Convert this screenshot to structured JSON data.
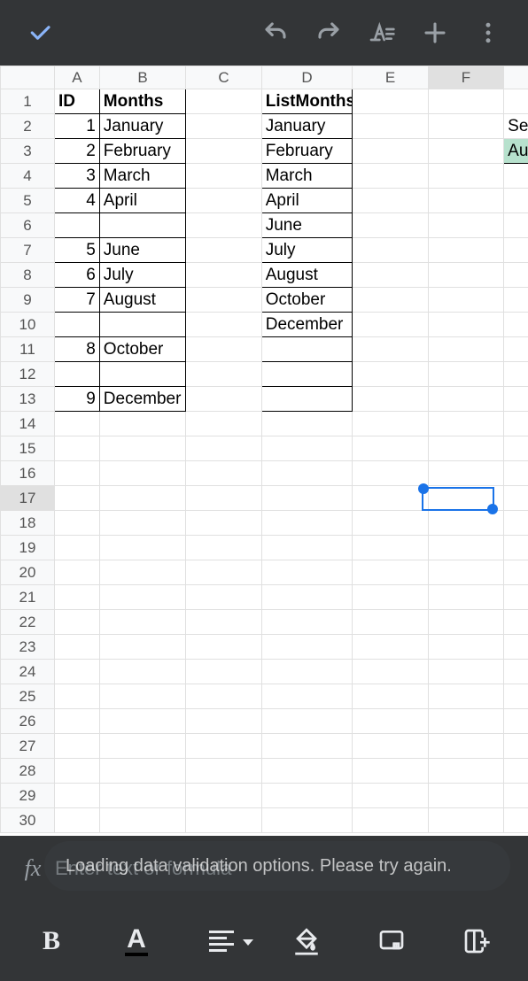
{
  "toolbar": {
    "check": "check",
    "undo": "undo",
    "redo": "redo",
    "text_format": "text-format",
    "plus": "plus",
    "more": "more"
  },
  "columns": [
    "A",
    "B",
    "C",
    "D",
    "E",
    "F"
  ],
  "rows_count": 30,
  "selected_col": "F",
  "selected_row": 17,
  "cells": {
    "A1": {
      "v": "ID",
      "bold": true,
      "bord": true
    },
    "B1": {
      "v": "Months",
      "bold": true,
      "bord": true
    },
    "D1": {
      "v": "ListMonths",
      "bold": true,
      "bord": true
    },
    "A2": {
      "v": "1",
      "num": true,
      "bord": true
    },
    "B2": {
      "v": "January",
      "bord": true
    },
    "D2": {
      "v": "January",
      "bord": true
    },
    "G2": {
      "v": "Sel"
    },
    "A3": {
      "v": "2",
      "num": true,
      "bord": true
    },
    "B3": {
      "v": "February",
      "bord": true
    },
    "D3": {
      "v": "February",
      "bord": true
    },
    "G3": {
      "v": "Aug",
      "green": true,
      "bord": true
    },
    "A4": {
      "v": "3",
      "num": true,
      "bord": true
    },
    "B4": {
      "v": "March",
      "bord": true
    },
    "D4": {
      "v": "March",
      "bord": true
    },
    "A5": {
      "v": "4",
      "num": true,
      "bord": true
    },
    "B5": {
      "v": "April",
      "bord": true
    },
    "D5": {
      "v": "April",
      "bord": true
    },
    "A6": {
      "v": "",
      "bord": true
    },
    "B6": {
      "v": "",
      "bord": true
    },
    "D6": {
      "v": "June",
      "bord": true
    },
    "A7": {
      "v": "5",
      "num": true,
      "bord": true
    },
    "B7": {
      "v": "June",
      "bord": true
    },
    "D7": {
      "v": "July",
      "bord": true
    },
    "A8": {
      "v": "6",
      "num": true,
      "bord": true
    },
    "B8": {
      "v": "July",
      "bord": true
    },
    "D8": {
      "v": "August",
      "bord": true
    },
    "A9": {
      "v": "7",
      "num": true,
      "bord": true
    },
    "B9": {
      "v": "August",
      "bord": true
    },
    "D9": {
      "v": "October",
      "bord": true
    },
    "A10": {
      "v": "",
      "bord": true
    },
    "B10": {
      "v": "",
      "bord": true
    },
    "D10": {
      "v": "December",
      "bord": true
    },
    "A11": {
      "v": "8",
      "num": true,
      "bord": true
    },
    "B11": {
      "v": "October",
      "bord": true
    },
    "D11": {
      "v": "",
      "bord": true
    },
    "A12": {
      "v": "",
      "bord": true
    },
    "B12": {
      "v": "",
      "bord": true
    },
    "D12": {
      "v": "",
      "bord": true
    },
    "A13": {
      "v": "9",
      "num": true,
      "bord": true
    },
    "B13": {
      "v": "December",
      "bord": true
    },
    "D13": {
      "v": "",
      "bord": true
    }
  },
  "formula_placeholder": "Enter text or formula",
  "toast_text": "Loading data validation options. Please try again.",
  "bottombar": {
    "bold": "B",
    "textcolor": "A",
    "align": "align",
    "fill": "fill",
    "comment": "comment",
    "insert": "insert"
  }
}
